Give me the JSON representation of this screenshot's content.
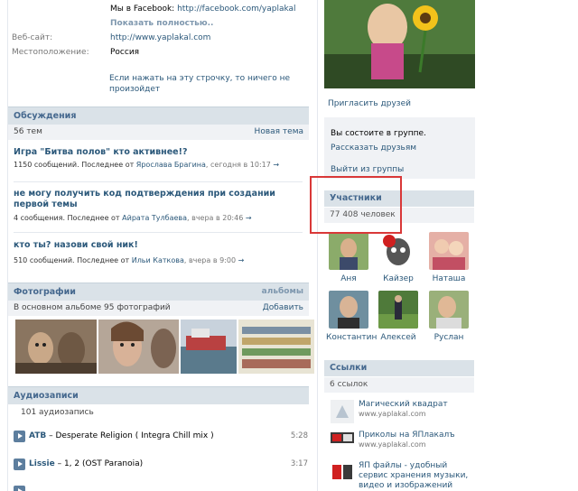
{
  "info": {
    "facebook_prefix": "Мы в Facebook:",
    "facebook_url": "http://facebook.com/yaplakal",
    "show_full": "Показать полностью..",
    "website_label": "Веб-сайт:",
    "website_value": "http://www.yaplakal.com",
    "location_label": "Местоположение:",
    "location_value": "Россия",
    "status_line1": "Если нажать на эту строчку, то ничего не",
    "status_line2": "произойдет"
  },
  "discussions": {
    "title": "Обсуждения",
    "count": "56 тем",
    "new_topic": "Новая тема",
    "topics": [
      {
        "title": "Игра \"Битва полов\" кто активнее!?",
        "stats": "1150 сообщений. Последнее от",
        "user": "Ярослава Брагина",
        "date": "сегодня в 10:17",
        "arrow": "→"
      },
      {
        "title": "не могу получить код подтверждения при создании первой темы",
        "stats": "4 сообщения. Последнее от",
        "user": "Айрата Тулбаева",
        "date": "вчера в 20:46",
        "arrow": "→"
      },
      {
        "title": "кто ты? назови свой ник!",
        "stats": "510 сообщений. Последнее от",
        "user": "Ильи Каткова",
        "date": "вчера в 9:00",
        "arrow": "→"
      }
    ]
  },
  "photos": {
    "title": "Фотографии",
    "albums": "альбомы",
    "subtitle": "В основном альбоме 95 фотографий",
    "add": "Добавить"
  },
  "audio": {
    "title": "Аудиозаписи",
    "count": "101 аудиозапись",
    "tracks": [
      {
        "artist": "ATB",
        "title": " – Desperate Religion ( Integra Chill mix )",
        "duration": "5:28"
      },
      {
        "artist": "Lissie",
        "title": " – 1, 2 (OST Paranoia)",
        "duration": "3:17"
      }
    ]
  },
  "group": {
    "invite": "Пригласить друзей",
    "member_status": "Вы состоите в группе.",
    "tell_friends": "Рассказать друзьям",
    "leave": "Выйти из группы"
  },
  "members": {
    "title": "Участники",
    "count": "77 408 человек",
    "list": [
      {
        "name": "Аня"
      },
      {
        "name": "Кайзер"
      },
      {
        "name": "Наташа"
      },
      {
        "name": "Константин"
      },
      {
        "name": "Алексей"
      },
      {
        "name": "Руслан"
      }
    ]
  },
  "links": {
    "title": "Ссылки",
    "count": "6 ссылок",
    "items": [
      {
        "title": "Магический квадрат",
        "url": "www.yaplakal.com"
      },
      {
        "title": "Приколы на ЯПлакалъ",
        "url": "www.yaplakal.com"
      },
      {
        "title": "ЯП файлы - удобный сервис хранения музыки, видео и изображений",
        "url": ""
      }
    ]
  },
  "colors": {
    "accent": "#2b587a",
    "header_bg": "#dae2e8",
    "highlight": "#d93838"
  }
}
